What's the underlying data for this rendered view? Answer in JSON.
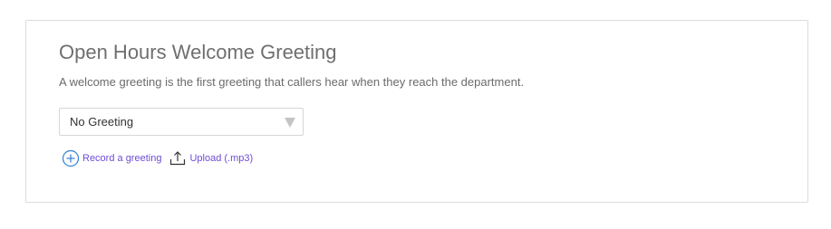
{
  "greeting": {
    "title": "Open Hours Welcome Greeting",
    "description": "A welcome greeting is the first greeting that callers hear when they reach the department.",
    "select": {
      "selected": "No Greeting"
    },
    "actions": {
      "record_label": "Record a greeting",
      "record_icon": "plus-circle-icon",
      "upload_label": "Upload (.mp3)",
      "upload_icon": "upload-icon"
    }
  },
  "colors": {
    "link": "#6f4bd8",
    "record_icon": "#2f7fd3",
    "title": "#6f6f6f",
    "border": "#dcdcdc"
  }
}
